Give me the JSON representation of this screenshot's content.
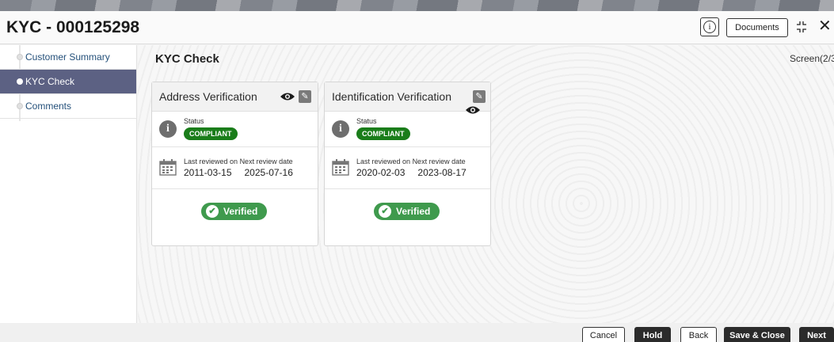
{
  "header": {
    "title": "KYC - 000125298",
    "info_glyph": "i",
    "documents_label": "Documents",
    "close_glyph": "✕"
  },
  "sidebar": {
    "items": [
      {
        "label": "Customer Summary",
        "active": false
      },
      {
        "label": "KYC Check",
        "active": true
      },
      {
        "label": "Comments",
        "active": false
      }
    ]
  },
  "main": {
    "section_title": "KYC Check",
    "screen_indicator": "Screen(2/3",
    "cards": [
      {
        "title": "Address Verification",
        "status_label": "Status",
        "status": "COMPLIANT",
        "last_reviewed_label": "Last reviewed on",
        "next_review_label": "Next review date",
        "last_reviewed": "2011-03-15",
        "next_review": "2025-07-16",
        "verified_label": "Verified"
      },
      {
        "title": "Identification Verification",
        "status_label": "Status",
        "status": "COMPLIANT",
        "last_reviewed_label": "Last reviewed on",
        "next_review_label": "Next review date",
        "last_reviewed": "2020-02-03",
        "next_review": "2023-08-17",
        "verified_label": "Verified"
      }
    ]
  },
  "footer": {
    "cancel_label": "Cancel",
    "hold_label": "Hold",
    "back_label": "Back",
    "save_close_label": "Save & Close",
    "next_label": "Next"
  },
  "colors": {
    "active_nav": "#5c6183",
    "compliant_badge": "#1a7d1a",
    "verified_button": "#3f9a4d",
    "dark_button": "#2b2b2b"
  },
  "icons": [
    "info-icon",
    "expand-icon",
    "close-icon",
    "eye-icon",
    "edit-icon",
    "calendar-icon",
    "check-circle-icon"
  ]
}
